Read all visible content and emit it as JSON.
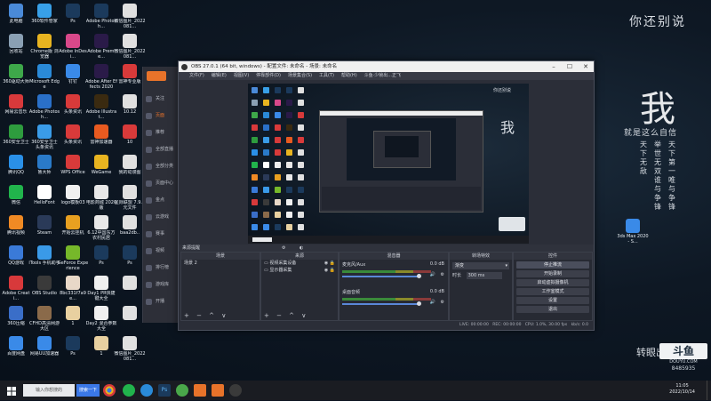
{
  "desktop": {
    "icons_col1": [
      {
        "label": "此电脑",
        "color": "#4a8ad8"
      },
      {
        "label": "回收站",
        "color": "#8aa0b4"
      },
      {
        "label": "360驱动大师",
        "color": "#3ea84a"
      },
      {
        "label": "网易云音乐",
        "color": "#d8393b"
      },
      {
        "label": "360安全卫士",
        "color": "#2e9c3e"
      },
      {
        "label": "腾讯QQ",
        "color": "#2a90e8"
      },
      {
        "label": "微信",
        "color": "#21b44c"
      },
      {
        "label": "腾讯视频",
        "color": "#f08a24"
      },
      {
        "label": "QQ游戏",
        "color": "#3a7ad8"
      },
      {
        "label": "Adobe Creati...",
        "color": "#d8393b"
      },
      {
        "label": "360压缩",
        "color": "#3a6ec8"
      },
      {
        "label": "百度网盘",
        "color": "#3a8ae8"
      }
    ],
    "icons_col2": [
      {
        "label": "360软件管家",
        "color": "#38a0e8"
      },
      {
        "label": "Chrome版 浏览器",
        "color": "#e8b420"
      },
      {
        "label": "Microsoft Edge",
        "color": "#2a8ad8"
      },
      {
        "label": "Adobe Photosh...",
        "color": "#2a70c8"
      },
      {
        "label": "360安全卫士 头条资讯",
        "color": "#3a9ce8"
      },
      {
        "label": "鲁大师",
        "color": "#2a7ac8"
      },
      {
        "label": "HelloFont",
        "color": "#ffffff"
      },
      {
        "label": "Steam",
        "color": "#2a3a58"
      },
      {
        "label": "iTools 手机助手",
        "color": "#3a9ae8"
      },
      {
        "label": "OBS Studio",
        "color": "#3a3a3a"
      },
      {
        "label": "CFHD高清网游大区",
        "color": "#8a6a4a"
      },
      {
        "label": "网易UU加速器",
        "color": "#3a8ae8"
      }
    ],
    "icons_col3": [
      {
        "label": "Ps",
        "color": "#1b3a5c"
      },
      {
        "label": "Adobe InDesi...",
        "color": "#d8488a"
      },
      {
        "label": "钉钉",
        "color": "#3a8ae8"
      },
      {
        "label": "头条资讯",
        "color": "#d83a3a"
      },
      {
        "label": "头条资讯",
        "color": "#d83a3a"
      },
      {
        "label": "WPS Office",
        "color": "#d83a3a"
      },
      {
        "label": "logo模板03",
        "color": "#f0f0f0"
      },
      {
        "label": "开始云挂机",
        "color": "#e8a020"
      },
      {
        "label": "GeForce Experience",
        "color": "#76b82a"
      },
      {
        "label": "8bc331f7a9e...",
        "color": "#e8d8c8"
      },
      {
        "label": "1",
        "color": "#e8d0a0"
      },
      {
        "label": "Ps",
        "color": "#1b3a5c"
      }
    ],
    "icons_col4": [
      {
        "label": "Adobe Photosh...",
        "color": "#1b3a5c"
      },
      {
        "label": "Adobe Premie...",
        "color": "#2a1a48"
      },
      {
        "label": "Adobe After Effects 2020",
        "color": "#2a1a48"
      },
      {
        "label": "Adobe Illustrat...",
        "color": "#3a2a10"
      },
      {
        "label": "雷神加速器",
        "color": "#e85a20"
      },
      {
        "label": "WeGame",
        "color": "#e8b420"
      },
      {
        "label": "电影商城 2020版",
        "color": "#e8e8e8"
      },
      {
        "label": "6.12中国东方 农村民居",
        "color": "#e8e8e8"
      },
      {
        "label": "Ps",
        "color": "#1b3a5c"
      },
      {
        "label": "Day1 PR快捷 键大全",
        "color": "#f0f0f0"
      },
      {
        "label": "Day2 混合参数大全",
        "color": "#f0f0f0"
      },
      {
        "label": "1",
        "color": "#e8d0a0"
      }
    ],
    "icons_col5": [
      {
        "label": "微信图片_2022081...",
        "color": "#e0e0e0"
      },
      {
        "label": "微信图片_2022081...",
        "color": "#e0e0e0"
      },
      {
        "label": "雷神专业版",
        "color": "#d83a3a"
      },
      {
        "label": "10.12",
        "color": "#e0e0e0"
      },
      {
        "label": "10",
        "color": "#d83a3a"
      },
      {
        "label": "我的动漫图",
        "color": "#e0e0e0"
      },
      {
        "label": "星际联盟 7.9.9元文件",
        "color": "#e0e0e0"
      },
      {
        "label": "baa2db..",
        "color": "#e0e0e0"
      },
      {
        "label": "Ps",
        "color": "#1b3a5c"
      },
      {
        "label": "",
        "color": "#e0e0e0"
      },
      {
        "label": "",
        "color": "#e0e0e0"
      },
      {
        "label": "微信图片_2022081...",
        "color": "#e0e0e0"
      }
    ],
    "extra_icon": {
      "label": "3ds Max 2020 - S...",
      "color": "#3a8ae8"
    }
  },
  "wallpaper": {
    "heading": "你还别说",
    "big_char": "我",
    "subline": "就是这么自信",
    "col1": [
      "天下第一",
      "唯",
      "与",
      "争",
      "锋"
    ],
    "col2": [
      "举世无双",
      "谁",
      "与",
      "争",
      "锋"
    ],
    "col3": [
      "天下无敌"
    ],
    "bottom_text": "转眼出",
    "watermark": "斗鱼",
    "watermark_id": "8485935",
    "watermark_url": "DOUYU.COM"
  },
  "obs": {
    "title": "OBS 27.0.1 (64 bit, windows) - 配置文件: 未命名 - 场景: 未命名",
    "menu": [
      "文件(F)",
      "编辑(E)",
      "视图(V)",
      "停靠部件(D)",
      "场景集合(S)",
      "工具(T)",
      "帮助(H)",
      "斗鱼·少帧出...正飞"
    ],
    "no_source": "来源提醒",
    "docks": {
      "scenes": {
        "title": "场景",
        "items": [
          "场景 2"
        ]
      },
      "sources": {
        "title": "来源",
        "items": [
          "视频采集设备",
          "显示器采集"
        ]
      },
      "mixer": {
        "title": "混音器",
        "tracks": [
          {
            "name": "麦克风/Aux",
            "db": "0.0 dB"
          },
          {
            "name": "桌面音频",
            "db": "0.0 dB"
          }
        ]
      },
      "transitions": {
        "title": "转场特效",
        "type": "渐变",
        "duration_label": "时长",
        "duration": "300 ms"
      },
      "controls": {
        "title": "控件",
        "buttons": [
          "停止推流",
          "开始录制",
          "启动虚拟摄像机",
          "工作室模式",
          "设置",
          "退出"
        ]
      }
    },
    "status": {
      "live": "LIVE: 00:00:00",
      "rec": "REC: 00:00:00",
      "cpu": "CPU: 1.0%, 30.00 fps",
      "kbps": "kb/s: 0.0"
    },
    "dock_foot": "+ − ^ ∨"
  },
  "app_panel": {
    "items": [
      "关注",
      "页面",
      "推荐",
      "全部直播",
      "全部分类",
      "页面中心",
      "金点",
      "云游戏",
      "赛事",
      "视频",
      "排行榜",
      "游戏库",
      "开播"
    ]
  },
  "taskbar": {
    "search_placeholder": "输入你想搜的",
    "search_button": "搜索一下",
    "time": "11:05",
    "date": "2022/10/14"
  }
}
